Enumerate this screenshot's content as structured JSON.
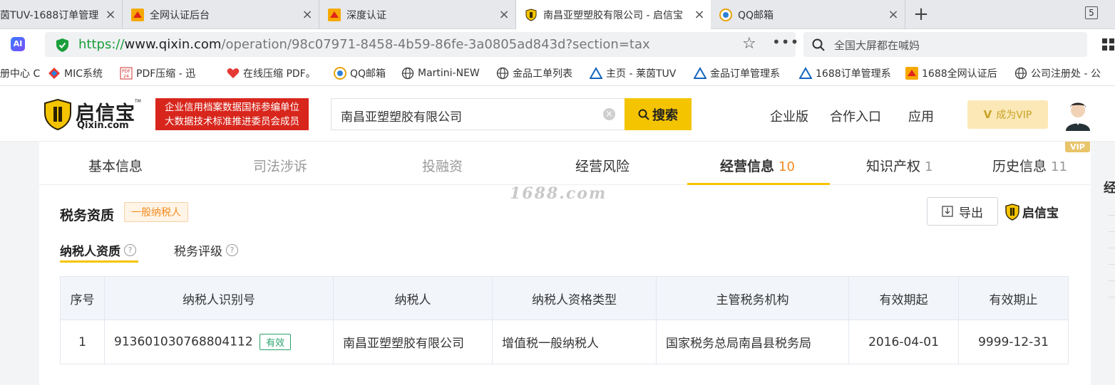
{
  "tabs": [
    {
      "title": "茵TUV-1688订单管理",
      "favicon": "none"
    },
    {
      "title": "全网认证后台",
      "favicon": "1688-icon"
    },
    {
      "title": "深度认证",
      "favicon": "1688-icon"
    },
    {
      "title": "南昌亚塑塑胶有限公司 - 启信宝",
      "favicon": "qixin-shield-icon"
    },
    {
      "title": "QQ邮箱",
      "favicon": "qq-mail-icon"
    }
  ],
  "tab_count": "5",
  "address": {
    "https": "https://",
    "host": "www.qixin.com",
    "path": "/operation/98c07971-8458-4b59-86fe-3a0805ad843d?section=tax"
  },
  "browser_search": {
    "text": "全国大屏都在喊妈"
  },
  "bookmarks": [
    {
      "label": "册中心 C",
      "icon": "none"
    },
    {
      "label": "MIC系统",
      "icon": "mic-icon"
    },
    {
      "label": "PDF压缩 - 迅",
      "icon": "pdf-icon"
    },
    {
      "label": "在线压缩 PDF。",
      "icon": "heart-icon"
    },
    {
      "label": "QQ邮箱",
      "icon": "qq-mail-icon"
    },
    {
      "label": "Martini-NEW",
      "icon": "globe-icon"
    },
    {
      "label": "金品工单列表",
      "icon": "globe-icon"
    },
    {
      "label": "主页 - 莱茵TUV",
      "icon": "triangle-icon"
    },
    {
      "label": "金品订单管理系",
      "icon": "triangle-icon"
    },
    {
      "label": "1688订单管理系",
      "icon": "triangle-icon"
    },
    {
      "label": "1688全网认证后",
      "icon": "1688-icon"
    },
    {
      "label": "公司注册处 - 公",
      "icon": "globe-icon"
    }
  ],
  "site": {
    "logo_cn": "启信宝",
    "logo_en": "Qixin.com",
    "logo_tm": "TM",
    "banner_line1": "企业信用档案数据国标参编单位",
    "banner_line2": "大数据技术标准推进委员会成员",
    "search_value": "南昌亚塑塑胶有限公司",
    "search_button": "搜索",
    "nav": [
      "企业版",
      "合作入口",
      "应用"
    ],
    "vip_button": "成为VIP",
    "vip_badge": "VIP"
  },
  "section_tabs": [
    {
      "label": "基本信息",
      "count": ""
    },
    {
      "label": "司法涉诉",
      "count": ""
    },
    {
      "label": "投融资",
      "count": ""
    },
    {
      "label": "经营风险",
      "count": ""
    },
    {
      "label": "经营信息",
      "count": "10"
    },
    {
      "label": "知识产权",
      "count": "1"
    },
    {
      "label": "历史信息",
      "count": "11"
    }
  ],
  "side_label": "经",
  "watermark": "1688.com",
  "tax": {
    "title": "税务资质",
    "badge": "一般纳税人",
    "export_label": "导出",
    "brand_label": "启信宝",
    "subtabs": [
      "纳税人资质",
      "税务评级"
    ],
    "columns": [
      "序号",
      "纳税人识别号",
      "纳税人",
      "纳税人资格类型",
      "主管税务机构",
      "有效期起",
      "有效期止"
    ],
    "rows": [
      {
        "no": "1",
        "id": "913601030768804112",
        "status": "有效",
        "payer": "南昌亚塑塑胶有限公司",
        "type": "增值税一般纳税人",
        "agency": "国家税务总局南昌县税务局",
        "start": "2016-04-01",
        "end": "9999-12-31"
      }
    ]
  },
  "colors": {
    "accent": "#f5c400",
    "active_underline": "#f5c400",
    "count_orange": "#f28a1f",
    "banner_red": "#d8261c",
    "url_green": "#1a9e3a",
    "status_green": "#2aa36a"
  }
}
